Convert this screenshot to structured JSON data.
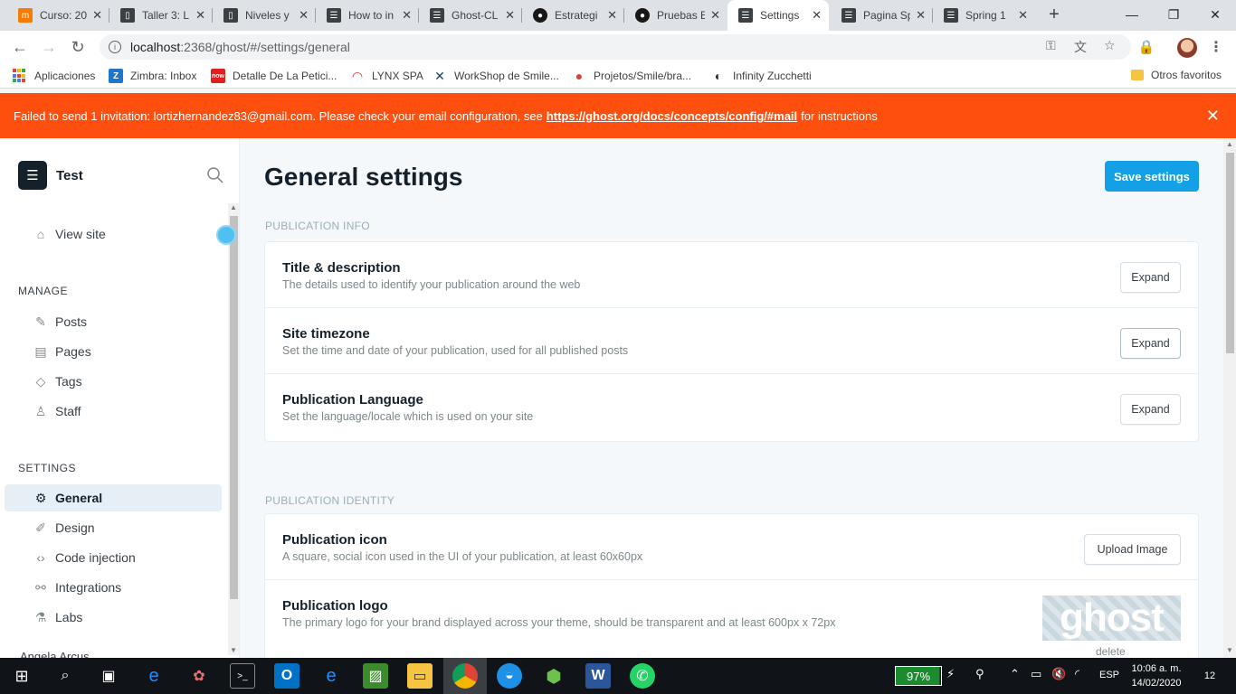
{
  "browser": {
    "tabs": [
      {
        "title": "Curso: 20",
        "icon": "course-icon",
        "color": "#f57c00"
      },
      {
        "title": "Taller 3: L",
        "icon": "book-icon",
        "color": "#3c4043"
      },
      {
        "title": "Niveles y",
        "icon": "book-icon",
        "color": "#3c4043"
      },
      {
        "title": "How to in",
        "icon": "ghost-icon",
        "color": "#3c4043"
      },
      {
        "title": "Ghost-CL",
        "icon": "ghost-icon",
        "color": "#3c4043"
      },
      {
        "title": "Estrategi",
        "icon": "github-icon",
        "color": "#181717"
      },
      {
        "title": "Pruebas E",
        "icon": "github-icon",
        "color": "#181717"
      },
      {
        "title": "Settings",
        "icon": "ghost-icon",
        "color": "#3c4043"
      },
      {
        "title": "Pagina Sp",
        "icon": "ghost-icon",
        "color": "#3c4043"
      },
      {
        "title": "Spring 1",
        "icon": "ghost-icon",
        "color": "#3c4043"
      }
    ],
    "url_host": "localhost",
    "url_path": ":2368/ghost/#/settings/general",
    "bookmarks": [
      {
        "label": "Aplicaciones",
        "icon": "apps-grid-icon"
      },
      {
        "label": "Zimbra: Inbox",
        "icon": "zimbra-icon",
        "badge": "Z",
        "color": "#1f75cb"
      },
      {
        "label": "Detalle De La Petici...",
        "icon": "now-icon",
        "badge": "now",
        "color": "#e02020"
      },
      {
        "label": "LYNX SPA",
        "icon": "lynx-icon",
        "badge": "◠",
        "color": "#d32f2f"
      },
      {
        "label": "WorkShop de Smile...",
        "icon": "workshop-icon",
        "badge": "✕",
        "color": "#1a3d6b"
      },
      {
        "label": "Projetos/Smile/bra...",
        "icon": "chrome-icon",
        "badge": "●",
        "color": "#db4437"
      },
      {
        "label": "Infinity Zucchetti",
        "icon": "infinity-icon",
        "badge": "◐",
        "color": "#333333"
      },
      {
        "label": "Otros favoritos",
        "icon": "folder-icon",
        "badge": "",
        "color": "#f5c542"
      }
    ]
  },
  "alert": {
    "text_before": "Failed to send 1 invitation: lortizhernandez83@gmail.com. Please check your email configuration, see",
    "link": "https://ghost.org/docs/concepts/config/#mail",
    "text_after": "for instructions"
  },
  "sidebar": {
    "site_name": "Test",
    "view_site": "View site",
    "manage_label": "MANAGE",
    "manage_items": [
      {
        "label": "Posts",
        "icon": "posts-icon"
      },
      {
        "label": "Pages",
        "icon": "pages-icon"
      },
      {
        "label": "Tags",
        "icon": "tag-icon"
      },
      {
        "label": "Staff",
        "icon": "staff-icon"
      }
    ],
    "settings_label": "SETTINGS",
    "settings_items": [
      {
        "label": "General",
        "icon": "gear-icon",
        "active": true
      },
      {
        "label": "Design",
        "icon": "brush-icon"
      },
      {
        "label": "Code injection",
        "icon": "code-icon"
      },
      {
        "label": "Integrations",
        "icon": "integrations-icon"
      },
      {
        "label": "Labs",
        "icon": "flask-icon"
      }
    ],
    "user_peek": "Angela Arcus"
  },
  "main": {
    "title": "General settings",
    "save_label": "Save settings",
    "sections": [
      {
        "label": "PUBLICATION INFO",
        "rows": [
          {
            "title": "Title & description",
            "desc": "The details used to identify your publication around the web",
            "action": "Expand"
          },
          {
            "title": "Site timezone",
            "desc": "Set the time and date of your publication, used for all published posts",
            "action": "Expand"
          },
          {
            "title": "Publication Language",
            "desc": "Set the language/locale which is used on your site",
            "action": "Expand"
          }
        ]
      },
      {
        "label": "PUBLICATION IDENTITY",
        "rows": [
          {
            "title": "Publication icon",
            "desc": "A square, social icon used in the UI of your publication, at least 60x60px",
            "action": "Upload Image"
          },
          {
            "title": "Publication logo",
            "desc": "The primary logo for your brand displayed across your theme, should be transparent and at least 600px x 72px",
            "logo_text": "ghost",
            "delete_label": "delete"
          }
        ]
      }
    ]
  },
  "taskbar": {
    "battery": "97%",
    "language": "ESP",
    "time": "10:06 a. m.",
    "date": "14/02/2020",
    "notifications": "12"
  },
  "colors": {
    "alert": "#fe4f0e",
    "accent": "#14a0e6",
    "sidebar_active": "#e5eff5"
  }
}
